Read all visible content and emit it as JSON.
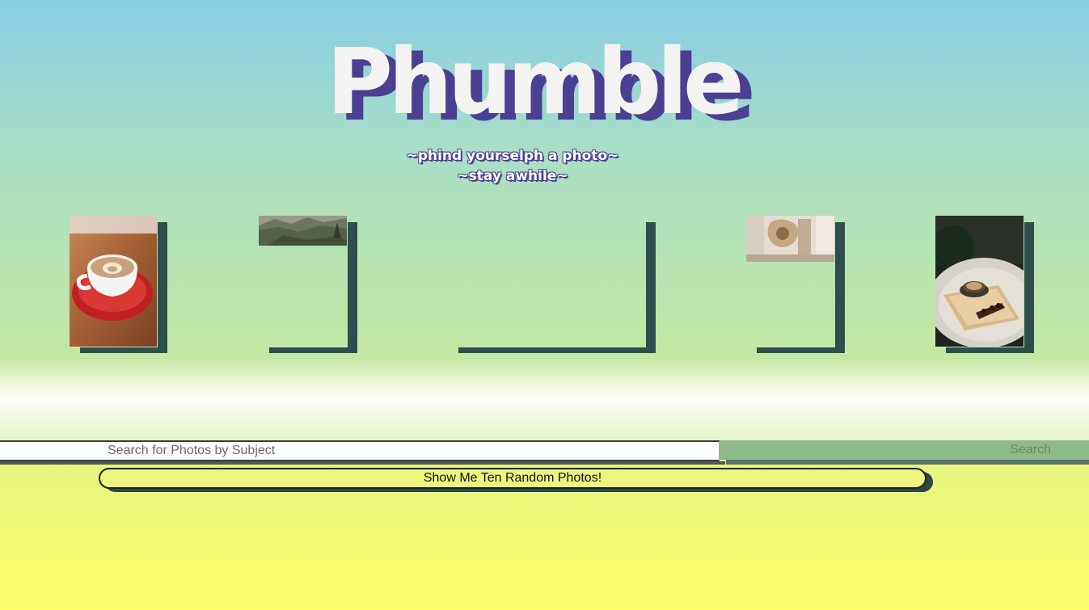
{
  "header": {
    "title": "Phumble",
    "tagline_1": "~phind yourselph a photo~",
    "tagline_2": "~stay awhile~"
  },
  "gallery": {
    "photos": [
      {
        "subject": "latte-art-coffee-cup"
      },
      {
        "subject": "mountain-landscape"
      },
      {
        "subject": "empty-photo"
      },
      {
        "subject": "ornate-interior"
      },
      {
        "subject": "coffee-on-marble-table"
      }
    ]
  },
  "search": {
    "placeholder": "Search for Photos by Subject",
    "button_label": "Search"
  },
  "random": {
    "button_label": "Show Me Ten Random Photos!"
  },
  "colors": {
    "title_fill": "#f5f3f1",
    "title_shadow": "#4b3f93",
    "photo_shadow": "#2e4e4e",
    "search_button": "#8fba8a",
    "random_button": "#ecf57e"
  }
}
